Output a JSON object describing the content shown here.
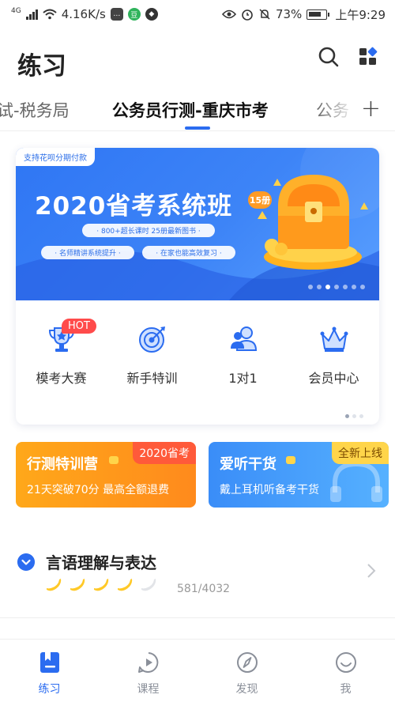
{
  "status_bar": {
    "network": "4G",
    "speed": "4.16K/s",
    "battery": "73%",
    "time": "上午9:29"
  },
  "header": {
    "title": "练习",
    "icons": [
      "search-icon",
      "grid-menu-icon"
    ]
  },
  "tabs": {
    "items": [
      {
        "label": "试-税务局"
      },
      {
        "label": "公务员行测-重庆市考",
        "active": true
      },
      {
        "label": "公务"
      }
    ],
    "add_label": "+"
  },
  "banner": {
    "tag": "支持花呗分期付款",
    "title": "2020省考系统班",
    "badge": "15册",
    "pill_1": "· 800+超长课时 25册最新图书 ·",
    "pill_2": "· 名师精讲系统提升 ·",
    "pill_3": "· 在家也能高效复习 ·",
    "page_count": 7,
    "current_page": 3
  },
  "quick_entries": [
    {
      "label": "模考大赛",
      "icon": "trophy-icon",
      "badge": "HOT"
    },
    {
      "label": "新手特训",
      "icon": "target-icon"
    },
    {
      "label": "1对1",
      "icon": "tutor-icon"
    },
    {
      "label": "会员中心",
      "icon": "crown-icon"
    }
  ],
  "promos": [
    {
      "title": "行测特训营",
      "subtitle": "21天突破70分 最高全额退费",
      "corner": "2020省考",
      "color": "#ff9a1c"
    },
    {
      "title": "爱听干货",
      "subtitle": "戴上耳机听备考干货",
      "corner": "全新上线",
      "color": "#3a8df8"
    }
  ],
  "section": {
    "title": "言语理解与表达",
    "progress": "581/4032",
    "rating": 4,
    "rating_max": 5
  },
  "bottom_nav": [
    {
      "label": "练习",
      "icon": "practice-icon",
      "active": true
    },
    {
      "label": "课程",
      "icon": "course-play-icon"
    },
    {
      "label": "发现",
      "icon": "compass-icon"
    },
    {
      "label": "我",
      "icon": "profile-smile-icon"
    }
  ],
  "colors": {
    "accent": "#2b6cf0",
    "orange": "#ff9a1c",
    "hot": "#ff4b4b"
  }
}
